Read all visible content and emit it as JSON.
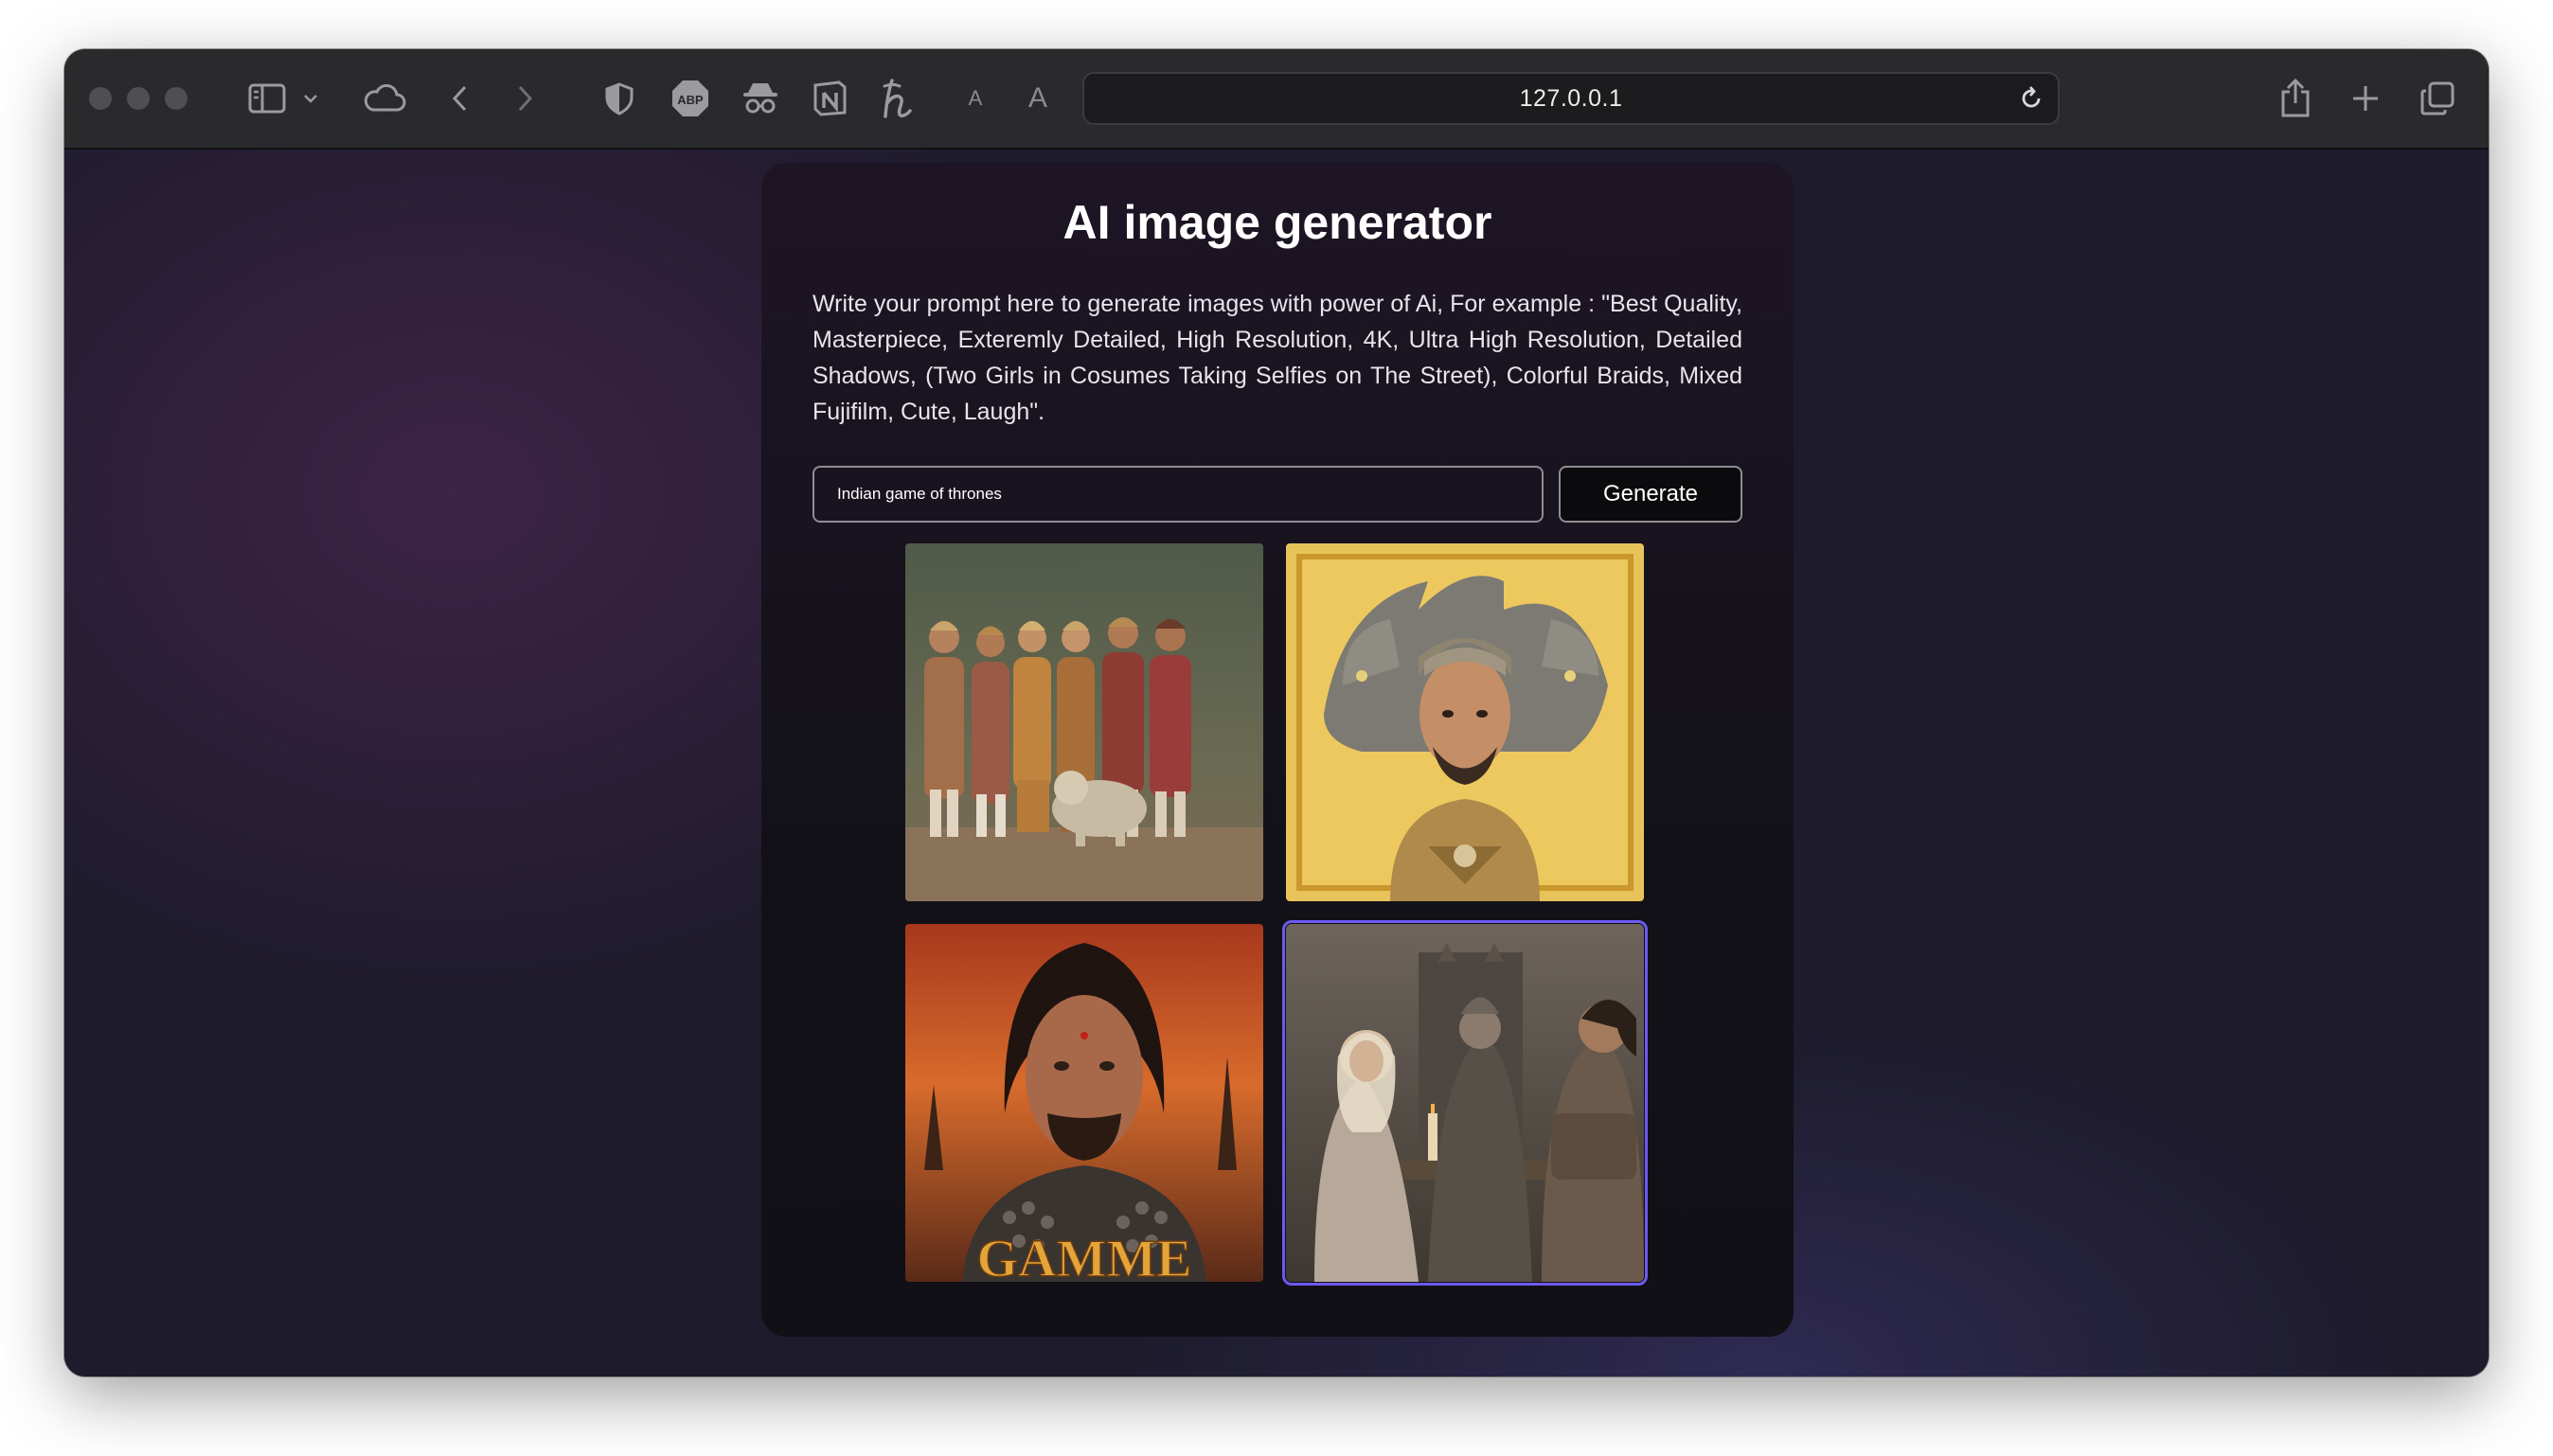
{
  "browser": {
    "url": "127.0.0.1",
    "icons": [
      "sidebar-icon",
      "chevron-down-icon",
      "cloud-icon",
      "back-icon",
      "forward-icon",
      "shield-icon",
      "adblock-icon",
      "spy-icon",
      "notion-icon",
      "h-icon",
      "font-small-icon",
      "font-large-icon",
      "reload-icon",
      "share-icon",
      "new-tab-icon",
      "tab-overview-icon"
    ],
    "adblock_label": "ABP",
    "font_small_label": "A",
    "font_large_label": "A"
  },
  "app": {
    "title": "AI image generator",
    "description": "Write your prompt here to generate images with power of Ai, For example : \"Best Quality, Masterpiece, Exteremly Detailed, High Resolution, 4K, Ultra High Resolution, Detailed Shadows, (Two Girls in Cosumes Taking Selfies on The Street), Colorful Braids, Mixed Fujifilm, Cute, Laugh\".",
    "prompt_value": "Indian game of thrones",
    "generate_label": "Generate",
    "images": [
      {
        "subject": "group of warriors with a dog"
      },
      {
        "subject": "man with dragons"
      },
      {
        "subject": "portrait poster",
        "caption": "GAMME"
      },
      {
        "subject": "throne room scene",
        "selected": true
      }
    ]
  },
  "colors": {
    "accent_selected": "#6d58f0",
    "background": "#1d1b2c",
    "card": "#121118"
  }
}
